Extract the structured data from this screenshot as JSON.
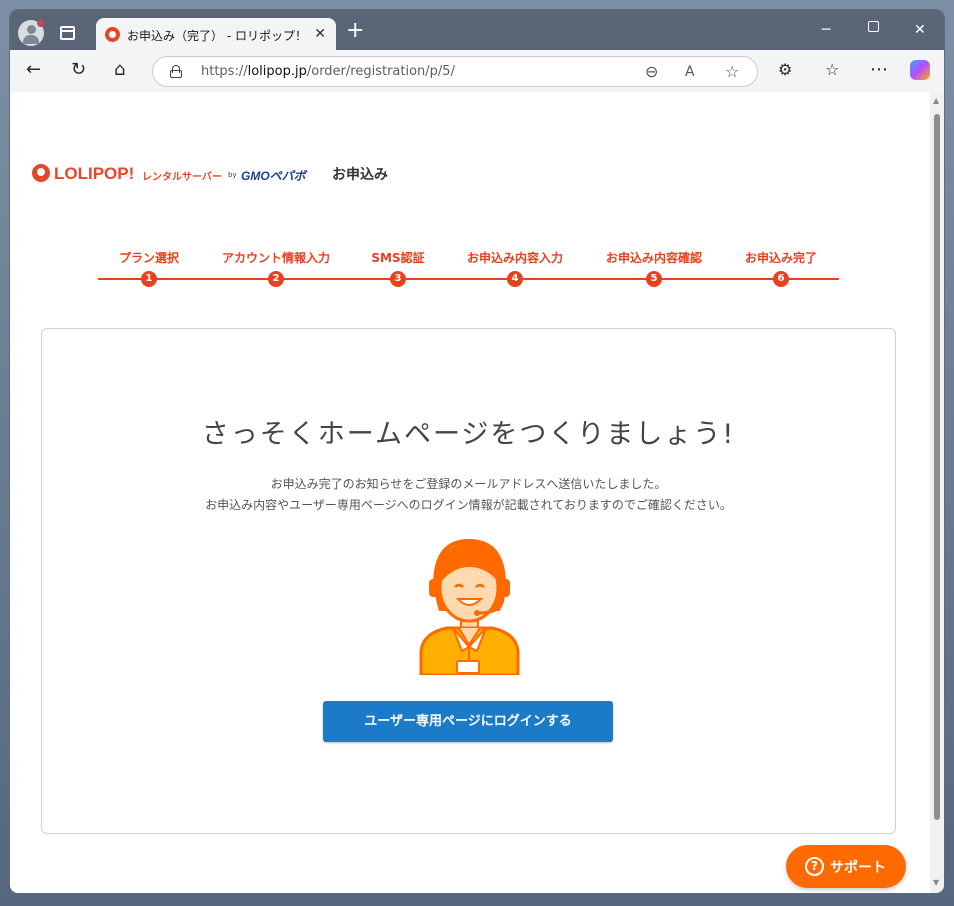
{
  "browser": {
    "tab_title": "お申込み（完了） - ロリポップ！レン",
    "url_prefix": "https://",
    "url_host": "lolipop.jp",
    "url_path": "/order/registration/p/5/"
  },
  "site": {
    "logo_text": "LOLIPOP!",
    "logo_sub": "レンタルサーバー",
    "logo_by": "by",
    "logo_gmo": "GMOペパボ",
    "page_heading": "お申込み"
  },
  "steps": [
    {
      "label": "プラン選択",
      "num": "1"
    },
    {
      "label": "アカウント情報入力",
      "num": "2"
    },
    {
      "label": "SMS認証",
      "num": "3"
    },
    {
      "label": "お申込み内容入力",
      "num": "4"
    },
    {
      "label": "お申込み内容確認",
      "num": "5"
    },
    {
      "label": "お申込み完了",
      "num": "6"
    }
  ],
  "main": {
    "title": "さっそくホームページをつくりましょう!",
    "message_line1": "お申込み完了のお知らせをご登録のメールアドレスへ送信いたしました。",
    "message_line2": "お申込み内容やユーザー専用ページへのログイン情報が記載されておりますのでご確認ください。",
    "login_button": "ユーザー専用ページにログインする"
  },
  "support": {
    "label": "サポート",
    "icon_glyph": "?"
  },
  "colors": {
    "brand": "#e8411f",
    "button_blue": "#1b7bc9",
    "support_orange": "#ff6a00"
  }
}
